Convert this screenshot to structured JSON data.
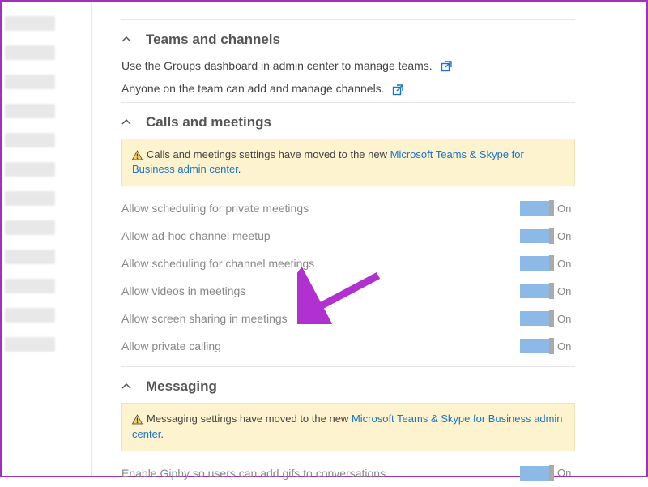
{
  "sections": {
    "teams": {
      "title": "Teams and channels",
      "line1": "Use the Groups dashboard in admin center to manage teams.",
      "line2": "Anyone on the team can add and manage channels."
    },
    "calls": {
      "title": "Calls and meetings",
      "notice_prefix": "Calls and meetings settings have moved to the new ",
      "notice_link": "Microsoft Teams & Skype for Business admin center",
      "notice_suffix": ".",
      "settings": [
        {
          "label": "Allow scheduling for private meetings",
          "state": "On"
        },
        {
          "label": "Allow ad-hoc channel meetup",
          "state": "On"
        },
        {
          "label": "Allow scheduling for channel meetings",
          "state": "On"
        },
        {
          "label": "Allow videos in meetings",
          "state": "On"
        },
        {
          "label": "Allow screen sharing in meetings",
          "state": "On"
        },
        {
          "label": "Allow private calling",
          "state": "On"
        }
      ]
    },
    "messaging": {
      "title": "Messaging",
      "notice_prefix": "Messaging settings have moved to the new ",
      "notice_link": "Microsoft Teams & Skype for Business admin center",
      "notice_suffix": ".",
      "settings": [
        {
          "label": "Enable Giphy so users can add gifs to conversations",
          "state": "On"
        }
      ]
    }
  }
}
